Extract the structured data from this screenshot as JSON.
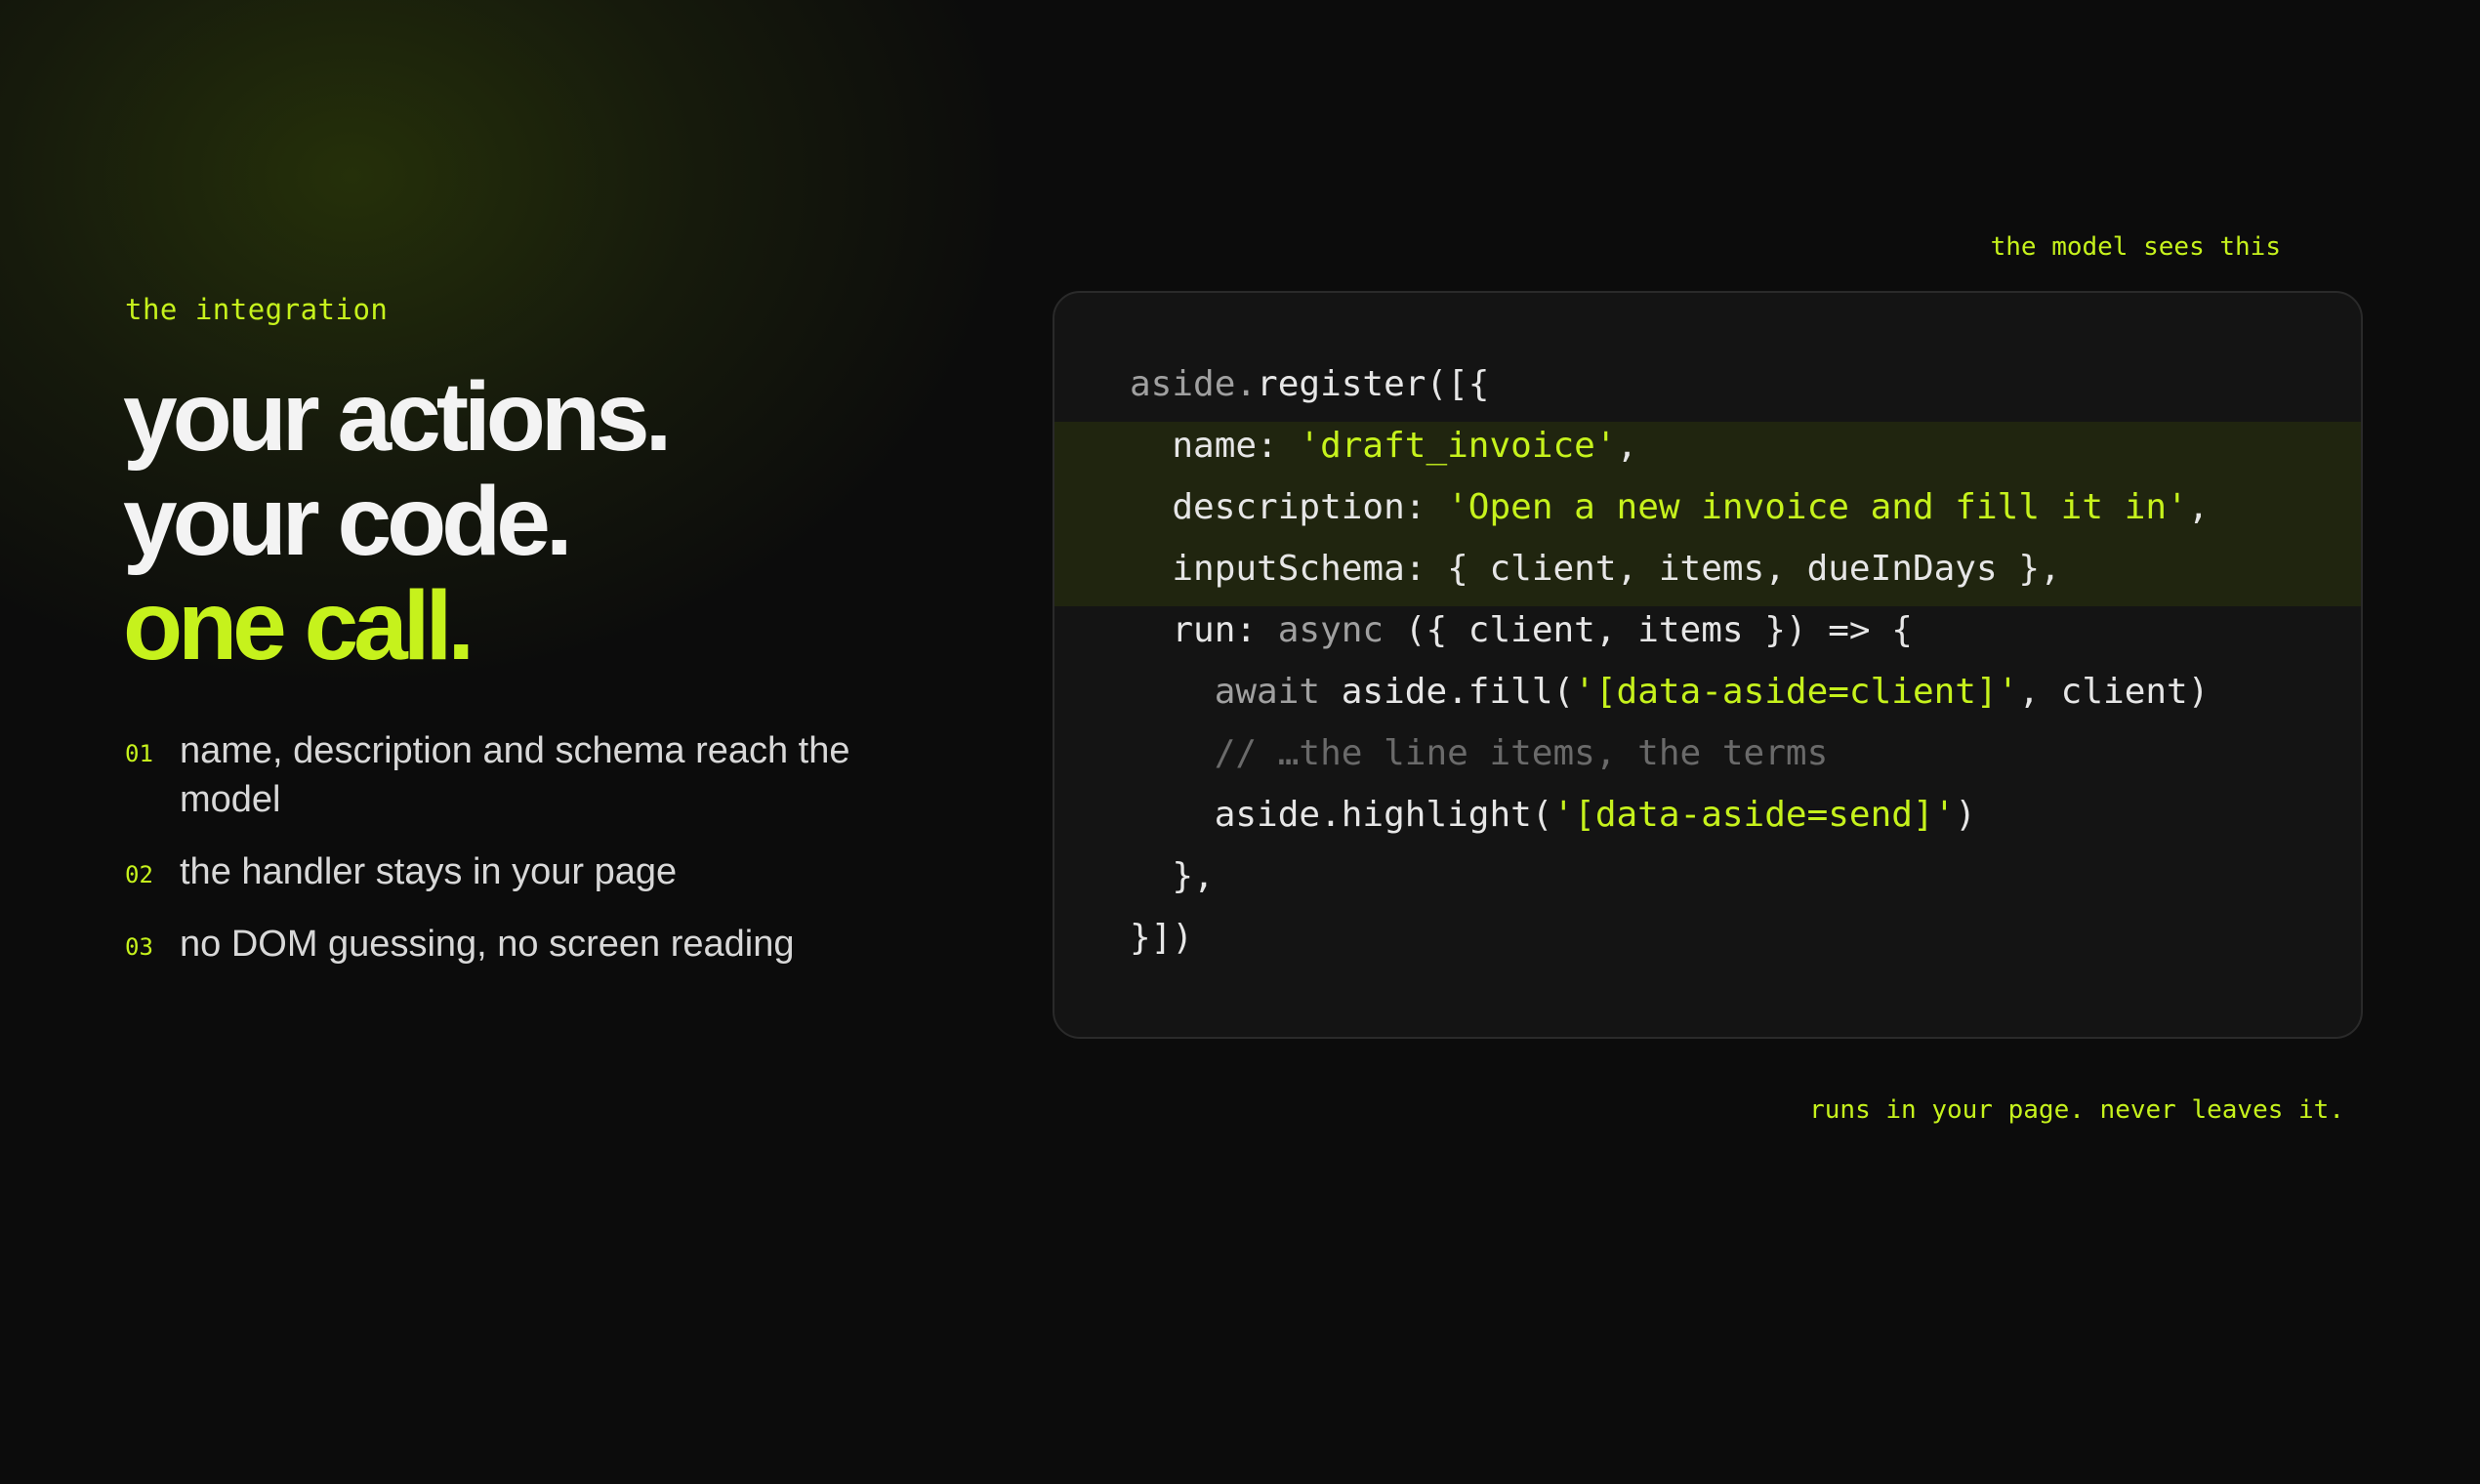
{
  "left": {
    "eyebrow": "the integration",
    "headline": [
      "your actions.",
      "your code.",
      "one call."
    ],
    "points": [
      {
        "num": "01",
        "text": "name, description and schema reach the model"
      },
      {
        "num": "02",
        "text": "the handler stays in your page"
      },
      {
        "num": "03",
        "text": "no DOM guessing, no screen reading"
      }
    ]
  },
  "code": {
    "caption_top": "the model sees this",
    "caption_bottom": "runs in your page. never leaves it.",
    "accent_color": "#c6f21c",
    "lines": [
      {
        "indent": "",
        "parts": [
          [
            "dim",
            "aside."
          ],
          [
            "",
            "register([{"
          ]
        ]
      },
      {
        "indent": "  ",
        "parts": [
          [
            "",
            "name: "
          ],
          [
            "str",
            "'draft_invoice'"
          ],
          [
            "",
            ","
          ]
        ]
      },
      {
        "indent": "  ",
        "parts": [
          [
            "",
            "description: "
          ],
          [
            "str",
            "'Open a new invoice and fill it in'"
          ],
          [
            "",
            ","
          ]
        ]
      },
      {
        "indent": "  ",
        "parts": [
          [
            "",
            "inputSchema: { client, items, dueInDays },"
          ]
        ]
      },
      {
        "indent": "  ",
        "parts": [
          [
            "",
            "run: "
          ],
          [
            "dim",
            "async"
          ],
          [
            "",
            " ({ client, items }) => {"
          ]
        ]
      },
      {
        "indent": "    ",
        "parts": [
          [
            "dim",
            "await"
          ],
          [
            "",
            " aside.fill("
          ],
          [
            "str",
            "'[data-aside=client]'"
          ],
          [
            "",
            ", client)"
          ]
        ]
      },
      {
        "indent": "    ",
        "parts": [
          [
            "cm",
            "// …the line items, the terms"
          ]
        ]
      },
      {
        "indent": "    ",
        "parts": [
          [
            "",
            "aside.highlight("
          ],
          [
            "str",
            "'[data-aside=send]'"
          ],
          [
            "",
            ")"
          ]
        ]
      },
      {
        "indent": "  ",
        "parts": [
          [
            "",
            "},"
          ]
        ]
      },
      {
        "indent": "",
        "parts": [
          [
            "",
            "}])"
          ]
        ]
      }
    ]
  }
}
